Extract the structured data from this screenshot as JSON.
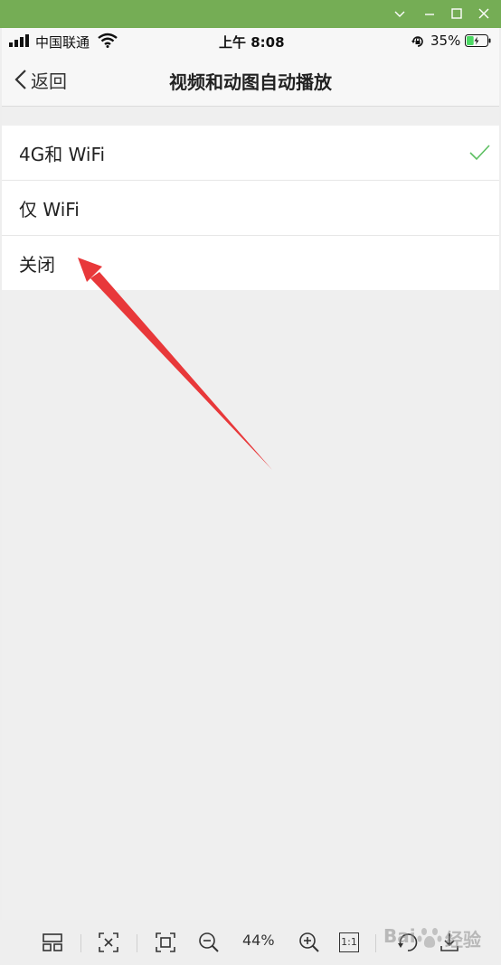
{
  "window": {
    "controls": [
      "chevron-down-icon",
      "minimize-icon",
      "maximize-icon",
      "close-icon"
    ]
  },
  "status_bar": {
    "carrier": "中国联通",
    "time": "上午 8:08",
    "battery": "35%",
    "battery_level": 0.35
  },
  "nav": {
    "back_label": "返回",
    "title": "视频和动图自动播放"
  },
  "options": [
    {
      "label": "4G和 WiFi",
      "selected": true
    },
    {
      "label": "仅 WiFi",
      "selected": false
    },
    {
      "label": "关闭",
      "selected": false
    }
  ],
  "annotation": {
    "arrow_color": "#e8383a"
  },
  "viewer_toolbar": {
    "zoom_level": "44%",
    "actual_size_label": "1:1"
  },
  "watermark": {
    "text_left": "Bai",
    "text_right": "经验"
  },
  "colors": {
    "title_bar": "#75ad55",
    "check": "#5cbf61",
    "battery_fill": "#4cd964"
  }
}
